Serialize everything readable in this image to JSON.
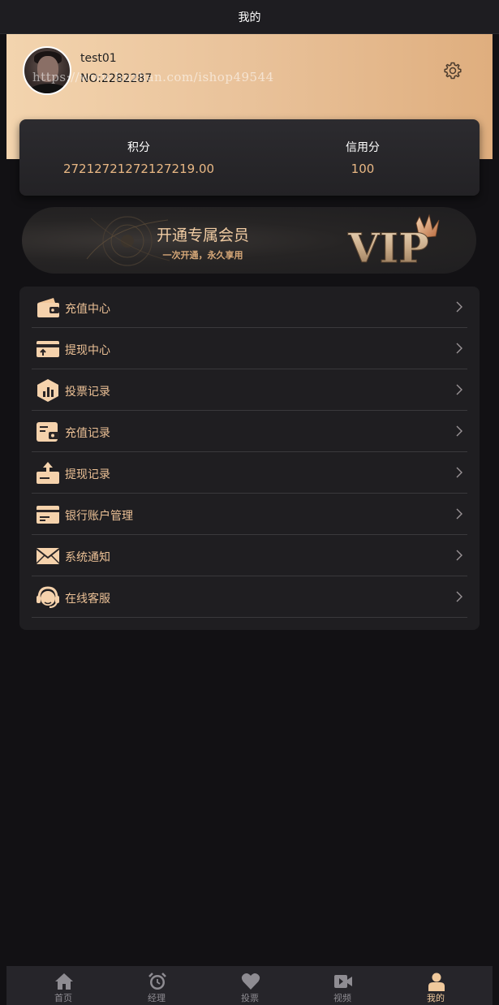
{
  "header": {
    "title": "我的"
  },
  "profile": {
    "username": "test01",
    "user_no": "NO:2282287",
    "watermark": "https://www.huzhan.com/ishop49544"
  },
  "stats": {
    "points_label": "积分",
    "points_value": "27212721272127219.00",
    "credit_label": "信用分",
    "credit_value": "100"
  },
  "vip_banner": {
    "title": "开通专属会员",
    "subtitle": "一次开通，永久享用",
    "logo_text": "VIP"
  },
  "menu": {
    "items": [
      {
        "label": "充值中心",
        "icon": "wallet-icon"
      },
      {
        "label": "提现中心",
        "icon": "withdraw-card-icon"
      },
      {
        "label": "投票记录",
        "icon": "bar-chart-hexagon-icon"
      },
      {
        "label": "充值记录",
        "icon": "wallet-record-icon"
      },
      {
        "label": "提现记录",
        "icon": "upload-tray-icon"
      },
      {
        "label": "银行账户管理",
        "icon": "bank-card-icon"
      },
      {
        "label": "系统通知",
        "icon": "envelope-icon"
      },
      {
        "label": "在线客服",
        "icon": "headset-icon"
      }
    ]
  },
  "tabbar": {
    "tabs": [
      {
        "label": "首页",
        "icon": "home-icon",
        "active": false
      },
      {
        "label": "经理",
        "icon": "alarm-clock-icon",
        "active": false
      },
      {
        "label": "投票",
        "icon": "heart-icon",
        "active": false
      },
      {
        "label": "视频",
        "icon": "video-camera-icon",
        "active": false
      },
      {
        "label": "我的",
        "icon": "user-icon",
        "active": true
      }
    ]
  },
  "colors": {
    "accent": "#e8b784",
    "background": "#121114",
    "card": "#1f1e21",
    "tab_active": "#f0c99c",
    "tab_inactive": "#8e8c92"
  }
}
